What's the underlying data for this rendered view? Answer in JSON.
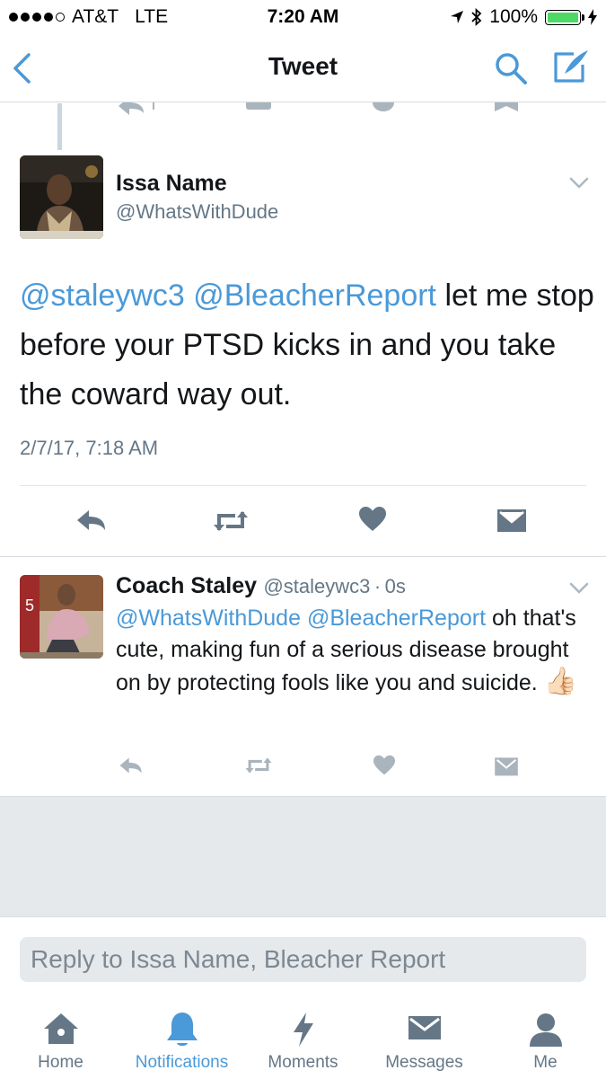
{
  "status_bar": {
    "carrier": "AT&T",
    "network": "LTE",
    "time": "7:20 AM",
    "battery": "100%"
  },
  "nav": {
    "title": "Tweet",
    "back_icon": "chevron-left-icon",
    "search_icon": "search-icon",
    "compose_icon": "compose-icon"
  },
  "main_tweet": {
    "name": "Issa Name",
    "handle": "@WhatsWithDude",
    "mention_1": "@staleywc3",
    "mention_2": "@BleacherReport",
    "text": " let me stop before your PTSD kicks in and you take the coward way out.",
    "timestamp": "2/7/17, 7:18 AM"
  },
  "reply_tweet": {
    "name": "Coach Staley",
    "handle": "@staleywc3",
    "separator": "·",
    "time": "0s",
    "mention_1": "@WhatsWithDude",
    "mention_2": "@BleacherReport",
    "text": " oh that's cute, making fun of a serious disease brought on by protecting fools like you and suicide. ",
    "emoji": "👍🏻"
  },
  "compose": {
    "placeholder": "Reply to Issa Name, Bleacher Report"
  },
  "tabs": [
    {
      "label": "Home",
      "icon": "home-icon"
    },
    {
      "label": "Notifications",
      "icon": "bell-icon",
      "active": true
    },
    {
      "label": "Moments",
      "icon": "lightning-icon"
    },
    {
      "label": "Messages",
      "icon": "envelope-icon"
    },
    {
      "label": "Me",
      "icon": "person-icon"
    }
  ],
  "colors": {
    "link": "#4a99d8",
    "icon_gray": "#a9b4bd",
    "icon_dark": "#657786",
    "active_tab": "#4a99d8"
  }
}
